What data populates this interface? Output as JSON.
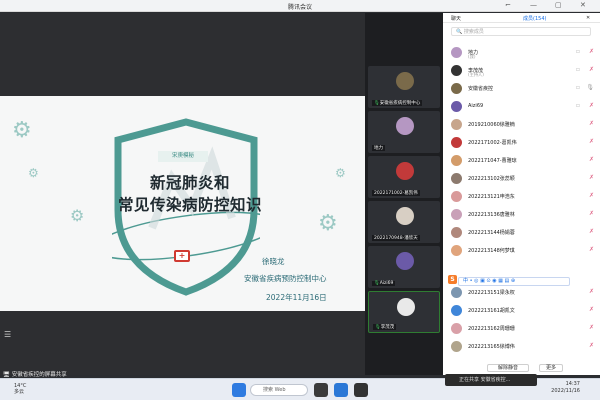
{
  "window": {
    "title": "腾讯会议",
    "controls": [
      "⌐",
      "—",
      "▢",
      "✕"
    ]
  },
  "slide": {
    "badge": "宋庚模秘",
    "title_line1": "新冠肺炎和",
    "title_line2": "常见传染病防控知识",
    "speaker_label": "徐晓龙",
    "org": "安徽省疾病预防控制中心",
    "date": "2022年11月16日"
  },
  "share_status": "安徽省疾控的屏幕共享",
  "video_tiles": [
    {
      "name": "安徽省疾病控制中心",
      "color": "#7a6a4a"
    },
    {
      "name": "地力",
      "color": "#b597c2"
    },
    {
      "name": "2022171002-葛凯伟",
      "color": "#c23a3a"
    },
    {
      "name": "2022170948-潘欣天",
      "color": "#d8cfc4"
    },
    {
      "name": "Aizi69",
      "color": "#6b5aa8"
    },
    {
      "name": "李茂茂",
      "color": "#e9e9e9"
    }
  ],
  "panel": {
    "tab_chat": "聊天",
    "tab_members": "成员(154)",
    "search_placeholder": "搜索成员",
    "members": [
      {
        "name": "地力",
        "sub": "(我)",
        "color": "#b597c2"
      },
      {
        "name": "李茂茂",
        "sub": "(主持人)",
        "color": "#333"
      },
      {
        "name": "安徽省疾控",
        "sub": "",
        "color": "#7a6a4a"
      },
      {
        "name": "Aizi69",
        "sub": "",
        "color": "#6b5aa8"
      },
      {
        "name": "2019210060徐雅楠",
        "sub": "",
        "color": "#c7a58c"
      },
      {
        "name": "2022171002-葛凯伟",
        "sub": "",
        "color": "#c23a3a"
      },
      {
        "name": "2022171047-曹雅琼",
        "sub": "",
        "color": "#d39c6a"
      },
      {
        "name": "2022213102张蕊颖",
        "sub": "",
        "color": "#8c7a6e"
      },
      {
        "name": "2022213121申浩东",
        "sub": "",
        "color": "#d99a9a"
      },
      {
        "name": "2022213136唐雅林",
        "sub": "",
        "color": "#c9a0b8"
      },
      {
        "name": "2022213144杨娟蓉",
        "sub": "",
        "color": "#b0887c"
      },
      {
        "name": "2022213148何梦琪",
        "sub": "",
        "color": "#e0a47c"
      },
      {
        "name": "2022213149张",
        "sub": "",
        "color": "#a9c4d8"
      },
      {
        "name": "2022213151梁永权",
        "sub": "",
        "color": "#7c96b0"
      },
      {
        "name": "2022213161胡凯文",
        "sub": "",
        "color": "#3f86d9"
      },
      {
        "name": "2022213162周珊珊",
        "sub": "",
        "color": "#d9a0a8"
      },
      {
        "name": "2022213165徐博伟",
        "sub": "",
        "color": "#b0a48c"
      }
    ],
    "toolbar_text": "中•◎▣⊙◉▦▤⊕",
    "mute_all": "解除静音",
    "more": "更多"
  },
  "taskbar": {
    "weather_temp": "14°C",
    "weather_desc": "多云",
    "search_label": "搜索 Web",
    "time": "14:37",
    "date": "2022/11/16"
  },
  "sharing_notice": "正在共享 安徽省疾控...",
  "icons": [
    "search-icon",
    "mic-icon",
    "mic-off-icon",
    "video-icon",
    "windows-start-icon",
    "list-icon",
    "first-aid-icon",
    "gear-icon"
  ],
  "colors": {
    "accent": "#1a6fe5",
    "slide_teal": "#3d8c85",
    "mic_muted": "#e06b8b",
    "mic_active": "#3fbf5c"
  }
}
